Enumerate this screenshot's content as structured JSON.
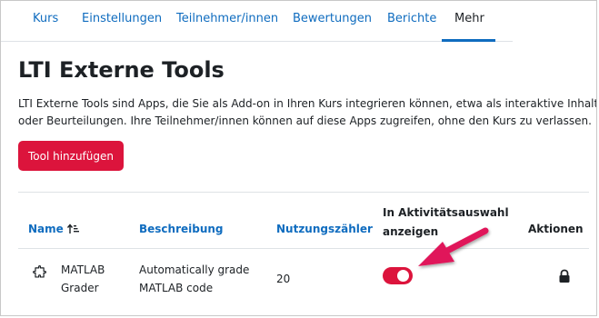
{
  "tabs": [
    {
      "label": "Kurs"
    },
    {
      "label": "Einstellungen"
    },
    {
      "label": "Teilnehmer/innen"
    },
    {
      "label": "Bewertungen"
    },
    {
      "label": "Berichte"
    },
    {
      "label": "Mehr",
      "active": true
    }
  ],
  "page": {
    "title": "LTI Externe Tools",
    "intro_line1": "LTI Externe Tools sind Apps, die Sie als Add-on in Ihren Kurs integrieren können, etwa als interaktive Inhalte",
    "intro_line2": "oder Beurteilungen. Ihre Teilnehmer/innen können auf diese Apps zugreifen, ohne den Kurs zu verlassen.",
    "add_button": "Tool hinzufügen"
  },
  "table": {
    "headers": {
      "name": "Name",
      "description": "Beschreibung",
      "usage": "Nutzungszähler",
      "show_line1": "In Aktivitätsauswahl",
      "show_line2": "anzeigen",
      "actions": "Aktionen"
    },
    "rows": [
      {
        "icon": "puzzle-piece-icon",
        "name_line1": "MATLAB",
        "name_line2": "Grader",
        "desc_line1": "Automatically grade",
        "desc_line2": "MATLAB code",
        "usage": "20",
        "show_in_chooser": true,
        "action_icon": "lock-icon"
      }
    ]
  },
  "colors": {
    "accent_link": "#0f6cbf",
    "brand_red": "#dc143c",
    "annotation_arrow": "#e0185a",
    "text": "#1d2125"
  }
}
